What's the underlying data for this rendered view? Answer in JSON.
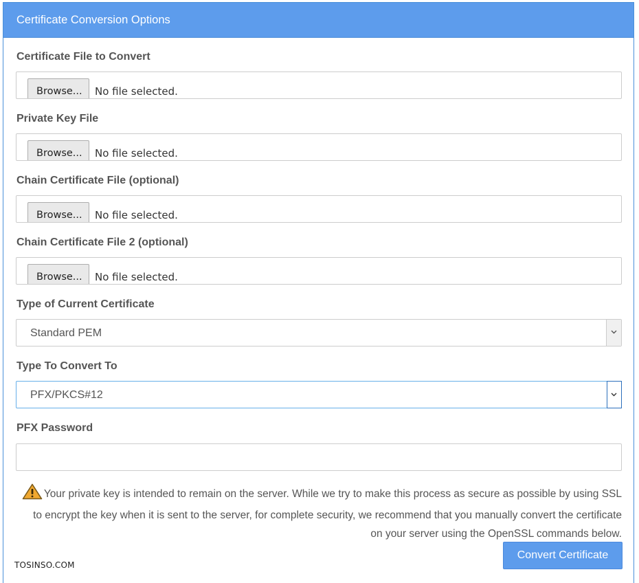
{
  "panel": {
    "title": "Certificate Conversion Options"
  },
  "fields": {
    "certificate_file": {
      "label": "Certificate File to Convert",
      "button": "Browse...",
      "status": "No file selected."
    },
    "private_key_file": {
      "label": "Private Key File",
      "button": "Browse...",
      "status": "No file selected."
    },
    "chain_file": {
      "label": "Chain Certificate File (optional)",
      "button": "Browse...",
      "status": "No file selected."
    },
    "chain_file_2": {
      "label": "Chain Certificate File 2 (optional)",
      "button": "Browse...",
      "status": "No file selected."
    },
    "current_type": {
      "label": "Type of Current Certificate",
      "selected": "Standard PEM"
    },
    "convert_to": {
      "label": "Type To Convert To",
      "selected": "PFX/PKCS#12"
    },
    "pfx_password": {
      "label": "PFX Password",
      "value": "",
      "placeholder": ""
    }
  },
  "warning": {
    "icon": "warning-triangle-icon",
    "text": "Your private key is intended to remain on the server. While we try to make this process as secure as possible by using SSL to encrypt the key when it is sent to the server, for complete security, we recommend that you manually convert the certificate on your server using the OpenSSL commands below."
  },
  "actions": {
    "convert_label": "Convert Certificate"
  },
  "watermark": {
    "text": "TOSINSO.COM"
  },
  "colors": {
    "accent": "#5d9cec",
    "warning": "#f0a830"
  }
}
